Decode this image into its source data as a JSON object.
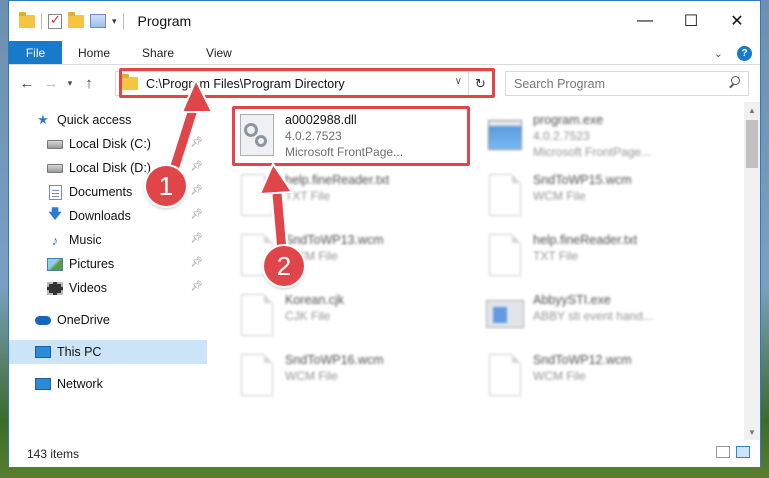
{
  "window": {
    "title": "Program",
    "minimize": "—",
    "maximize": "☐",
    "close": "✕"
  },
  "ribbon": {
    "tabs": [
      "File",
      "Home",
      "Share",
      "View"
    ],
    "help": "?"
  },
  "address": {
    "path": "C:\\Program Files\\Program Directory",
    "search_placeholder": "Search Program"
  },
  "sidebar": {
    "items": [
      {
        "label": "Quick access",
        "icon": "star-icon"
      },
      {
        "label": "Local Disk (C:)",
        "icon": "disk-icon",
        "pinned": true
      },
      {
        "label": "Local Disk (D:)",
        "icon": "disk-icon",
        "pinned": true
      },
      {
        "label": "Documents",
        "icon": "documents-icon",
        "pinned": true
      },
      {
        "label": "Downloads",
        "icon": "downloads-icon",
        "pinned": true
      },
      {
        "label": "Music",
        "icon": "music-icon",
        "pinned": true
      },
      {
        "label": "Pictures",
        "icon": "pictures-icon",
        "pinned": true
      },
      {
        "label": "Videos",
        "icon": "videos-icon",
        "pinned": true
      },
      {
        "label": "OneDrive",
        "icon": "onedrive-icon"
      },
      {
        "label": "This PC",
        "icon": "this-pc-icon",
        "selected": true
      },
      {
        "label": "Network",
        "icon": "network-icon"
      }
    ]
  },
  "files": [
    {
      "name": "a0002988.dll",
      "line2": "4.0.2.7523",
      "line3": "Microsoft FrontPage...",
      "icon": "dll-file-icon",
      "highlighted": true
    },
    {
      "name": "program.exe",
      "line2": "4.0.2.7523",
      "line3": "Microsoft FrontPage...",
      "icon": "exe-file-icon"
    },
    {
      "name": "help.fineReader.txt",
      "line2": "TXT File",
      "icon": "text-file-icon"
    },
    {
      "name": "SndToWP15.wcm",
      "line2": "WCM File",
      "icon": "generic-file-icon"
    },
    {
      "name": "SndToWP13.wcm",
      "line2": "WCM File",
      "icon": "generic-file-icon"
    },
    {
      "name": "help.fineReader.txt",
      "line2": "TXT File",
      "icon": "text-file-icon"
    },
    {
      "name": "Korean.cjk",
      "line2": "CJK File",
      "icon": "generic-file-icon"
    },
    {
      "name": "AbbyySTI.exe",
      "line2": "ABBY sti event hand...",
      "icon": "exe-file-icon"
    },
    {
      "name": "SndToWP16.wcm",
      "line2": "WCM File",
      "icon": "generic-file-icon"
    },
    {
      "name": "SndToWP12.wcm",
      "line2": "WCM File",
      "icon": "generic-file-icon"
    }
  ],
  "status": {
    "item_count": "143 items"
  },
  "annotations": {
    "step1": "1",
    "step2": "2",
    "highlight_color": "#e0454a"
  }
}
